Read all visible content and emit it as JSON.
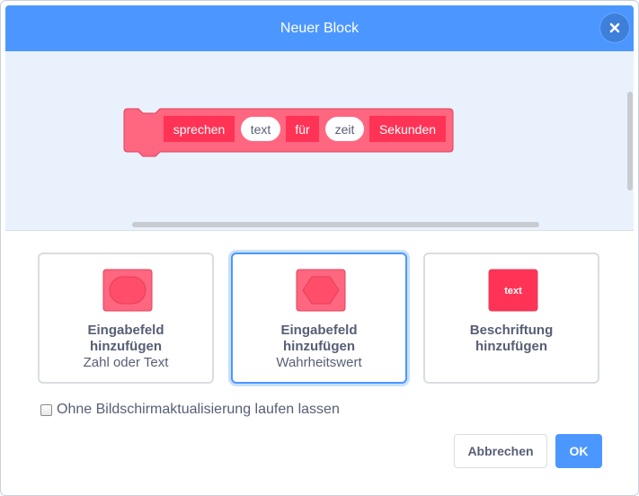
{
  "dialog": {
    "title": "Neuer Block",
    "close_icon": "close-icon"
  },
  "block": {
    "segments": [
      {
        "kind": "label",
        "text": "sprechen"
      },
      {
        "kind": "input",
        "text": "text"
      },
      {
        "kind": "label",
        "text": "für"
      },
      {
        "kind": "input",
        "text": "zeit"
      },
      {
        "kind": "label",
        "text": "Sekunden"
      }
    ],
    "fill_color": "#ff6680",
    "label_color": "#ff3355"
  },
  "options": [
    {
      "title": "Eingabefeld hinzufügen",
      "subtitle": "Zahl oder Text",
      "icon": "rounded-input-icon",
      "selected": false
    },
    {
      "title": "Eingabefeld hinzufügen",
      "subtitle": "Wahrheitswert",
      "icon": "boolean-input-icon",
      "selected": true
    },
    {
      "title": "Beschriftung hinzufügen",
      "subtitle": "",
      "icon": "label-text-icon",
      "icon_text": "text",
      "selected": false
    }
  ],
  "checkbox": {
    "label": "Ohne Bildschirmaktualisierung laufen lassen",
    "checked": false
  },
  "buttons": {
    "cancel": "Abbrechen",
    "ok": "OK"
  },
  "colors": {
    "accent": "#4c97ff",
    "workspace_bg": "#e9f1fc",
    "text": "#575e75"
  }
}
